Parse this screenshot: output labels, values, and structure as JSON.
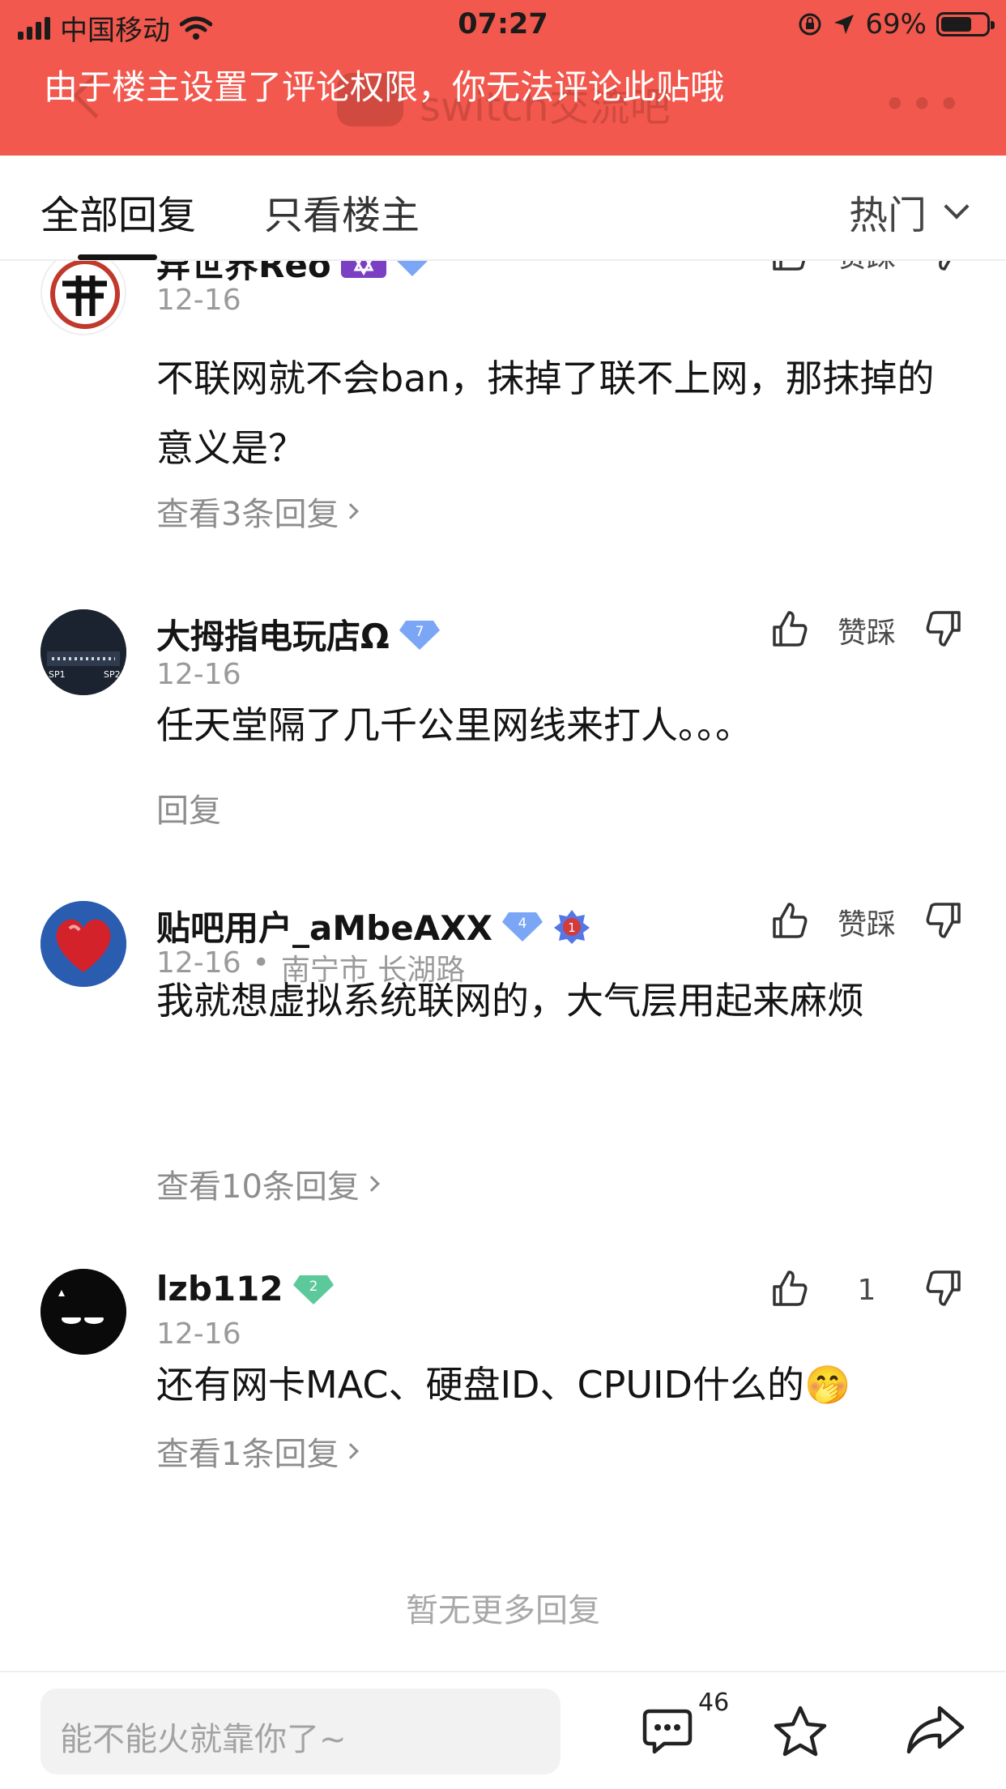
{
  "status": {
    "carrier": "中国移动",
    "time": "07:27",
    "battery": "69%",
    "battery_level": 0.69
  },
  "banner": {
    "notice": "由于楼主设置了评论权限，你无法评论此贴哦",
    "forum_title": "switch交流吧"
  },
  "tabs": {
    "all": "全部回复",
    "op_only": "只看楼主",
    "sort": "热门"
  },
  "replies": [
    {
      "name": "异世界Reo",
      "date": "12-16",
      "location": "",
      "text": "不联网就不会ban，抹掉了联不上网，那抹掉的意义是？",
      "more": "查看3条回复",
      "like_label": "赞踩",
      "level": ""
    },
    {
      "name": "大拇指电玩店Ω",
      "date": "12-16",
      "location": "",
      "text": "任天堂隔了几千公里网线来打人。。。",
      "more": "回复",
      "like_label": "赞踩",
      "level": "7"
    },
    {
      "name": "贴吧用户_aMbeAXX",
      "date": "12-16",
      "location": "南宁市 长湖路",
      "text": "我就想虚拟系统联网的，大气层用起来麻烦",
      "more": "查看10条回复",
      "like_label": "赞踩",
      "level": "4",
      "rank": "1"
    },
    {
      "name": "lzb112",
      "date": "12-16",
      "location": "",
      "text": "还有网卡MAC、硬盘ID、CPUID什么的",
      "emoji": "🤭",
      "more": "查看1条回复",
      "like_label": "1",
      "level": "2"
    }
  ],
  "footer": "暂无更多回复",
  "bottom_bar": {
    "placeholder": "能不能火就靠你了~",
    "comment_count": "46"
  },
  "colors": {
    "banner_red": "#f2584d",
    "level_blue": "#7aa6f5",
    "level_green": "#5cc99a"
  }
}
